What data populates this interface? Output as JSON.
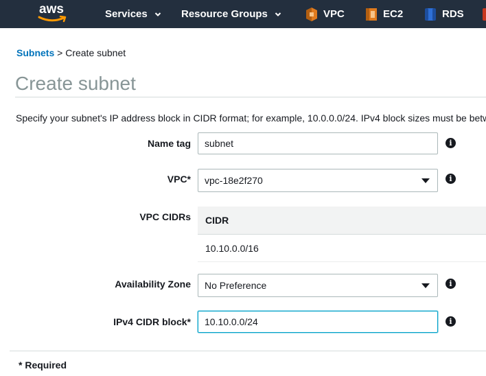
{
  "nav": {
    "logo_text": "aws",
    "items": [
      {
        "label": "Services"
      },
      {
        "label": "Resource Groups"
      }
    ],
    "shortcuts": [
      {
        "label": "VPC",
        "icon": "vpc-icon",
        "color": "#e07b1e"
      },
      {
        "label": "EC2",
        "icon": "ec2-icon",
        "color": "#e07b1e"
      },
      {
        "label": "RDS",
        "icon": "rds-icon",
        "color": "#2e6fd6"
      }
    ]
  },
  "breadcrumb": {
    "parent": "Subnets",
    "separator": ">",
    "current": "Create subnet"
  },
  "page": {
    "title": "Create subnet",
    "description": "Specify your subnet's IP address block in CIDR format; for example, 10.0.0.0/24. IPv4 block sizes must be betw"
  },
  "form": {
    "name_tag": {
      "label": "Name tag",
      "value": "subnet"
    },
    "vpc": {
      "label": "VPC*",
      "value": "vpc-18e2f270"
    },
    "vpc_cidrs": {
      "label": "VPC CIDRs",
      "column_header": "CIDR",
      "rows": [
        "10.10.0.0/16"
      ]
    },
    "availability_zone": {
      "label": "Availability Zone",
      "value": "No Preference"
    },
    "ipv4_cidr": {
      "label": "IPv4 CIDR block*",
      "value": "10.10.0.0/24"
    },
    "info_glyph": "i"
  },
  "footer": {
    "required_note": "* Required"
  },
  "colors": {
    "nav_bg": "#232f3e",
    "link": "#0073bb",
    "title": "#879596",
    "focus": "#00a1c9"
  }
}
